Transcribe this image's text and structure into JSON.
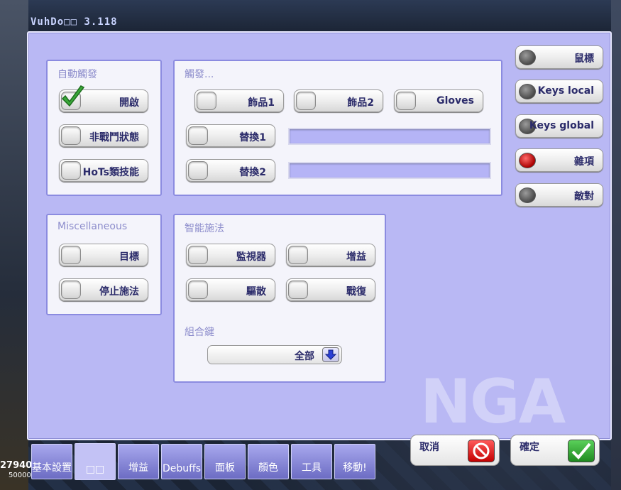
{
  "window": {
    "title": "VuhDo□□ 3.118"
  },
  "auto_trigger": {
    "title": "自動觸發",
    "items": [
      {
        "label": "開啟",
        "checked": true
      },
      {
        "label": "非戰鬥狀態",
        "checked": false
      },
      {
        "label": "HoTs類技能",
        "checked": false
      }
    ]
  },
  "trigger": {
    "title": "觸發...",
    "row1": [
      {
        "label": "飾品1"
      },
      {
        "label": "飾品2"
      },
      {
        "label": "Gloves"
      }
    ],
    "swap1": {
      "label": "替換1",
      "value": ""
    },
    "swap2": {
      "label": "替換2",
      "value": ""
    }
  },
  "misc": {
    "title": "Miscellaneous",
    "items": [
      {
        "label": "目標"
      },
      {
        "label": "停止施法"
      }
    ]
  },
  "smart_cast": {
    "title": "智能施法",
    "items": [
      {
        "label": "監視器"
      },
      {
        "label": "增益"
      },
      {
        "label": "驅散"
      },
      {
        "label": "戰復"
      }
    ],
    "combo_title": "組合鍵",
    "combo_value": "全部"
  },
  "side_tabs": [
    {
      "label": "鼠標",
      "selected": false
    },
    {
      "label": "Keys local",
      "selected": false
    },
    {
      "label": "Keys global",
      "selected": false
    },
    {
      "label": "雜項",
      "selected": true
    },
    {
      "label": "敵對",
      "selected": false
    }
  ],
  "bottom_tabs": [
    {
      "label": "基本設置"
    },
    {
      "label": "□□"
    },
    {
      "label": "增益"
    },
    {
      "label": "Debuffs"
    },
    {
      "label": "面板"
    },
    {
      "label": "顏色"
    },
    {
      "label": "工具"
    },
    {
      "label": "移動!"
    }
  ],
  "actions": {
    "cancel": "取消",
    "ok": "確定"
  },
  "background": {
    "stat_main": "27940",
    "stat_sub": "50000",
    "watermark": "NGA"
  },
  "colors": {
    "panel_bg": "#b9b8f4",
    "accent": "#8b8be0",
    "radio_on": "#cc0000",
    "ok_green": "#2a9e2a",
    "cancel_red": "#d42020"
  }
}
